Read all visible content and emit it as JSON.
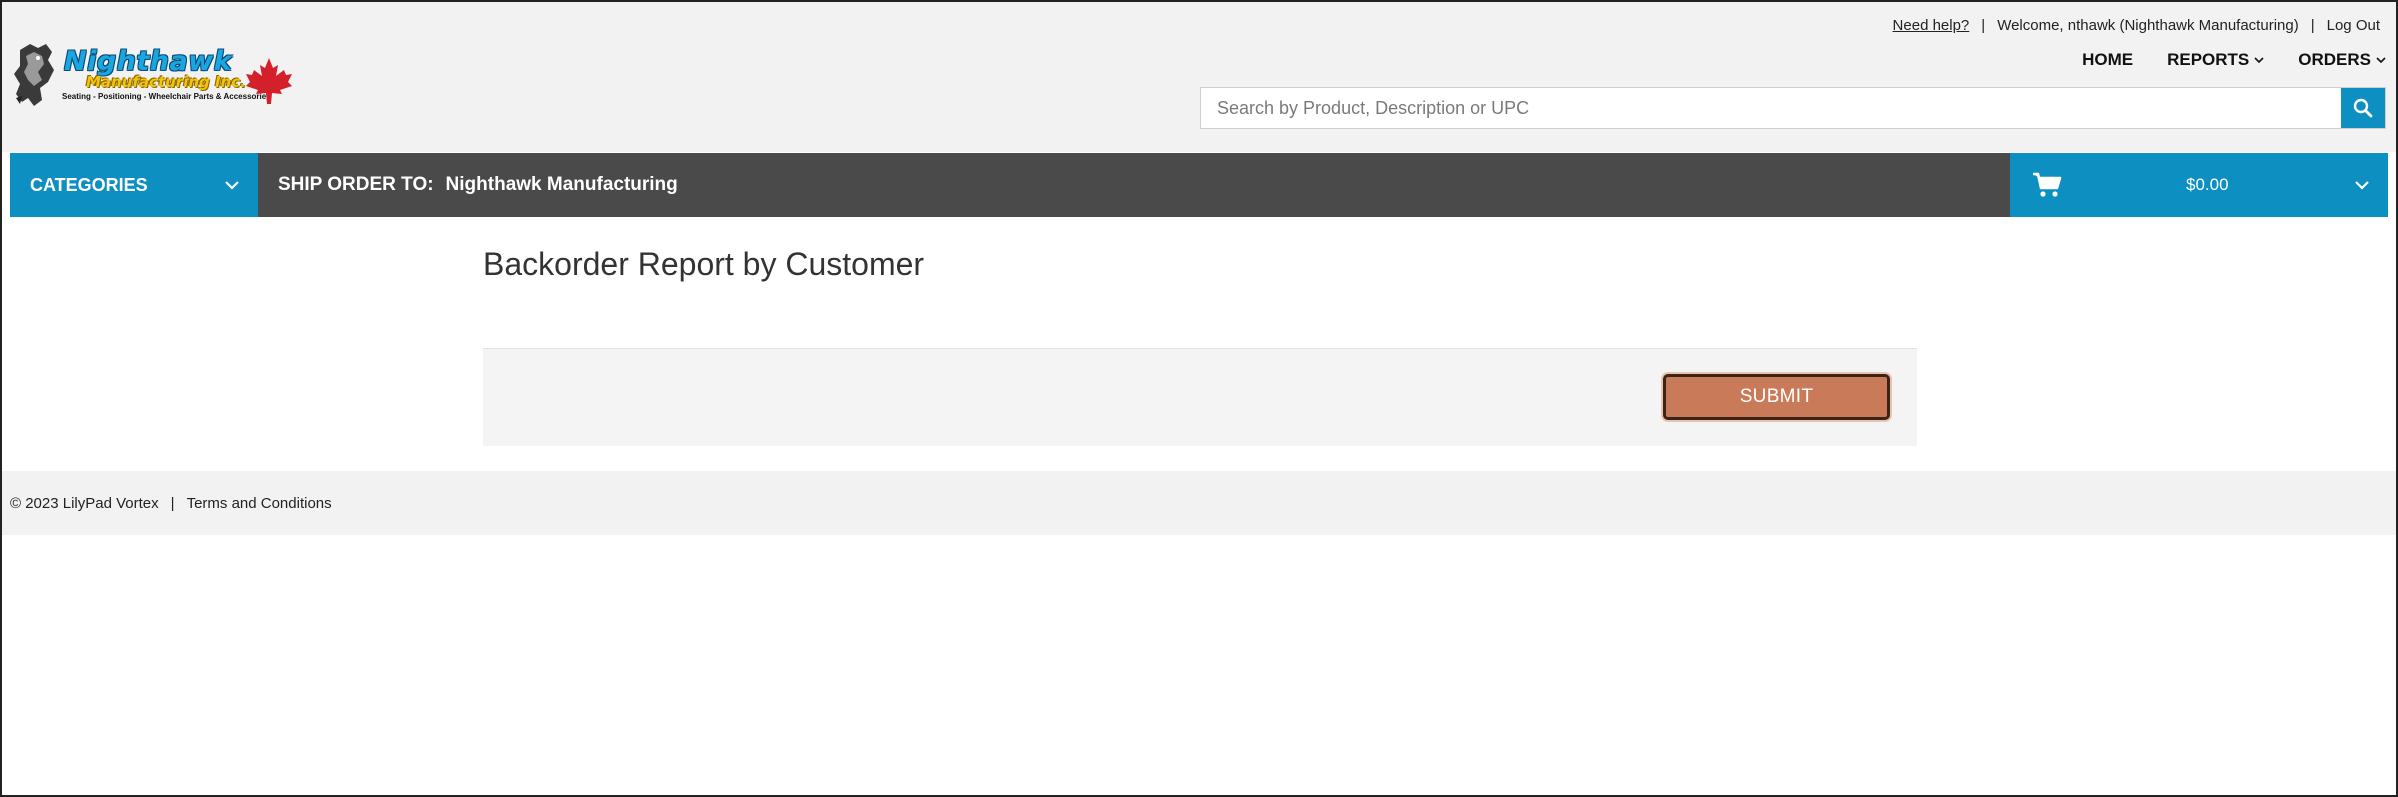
{
  "brand": {
    "name": "Nighthawk",
    "subname": "Manufacturing Inc.",
    "tagline": "Seating - Positioning - Wheelchair Parts & Accessories"
  },
  "top_links": {
    "help": "Need help?",
    "welcome": "Welcome, nthawk (Nighthawk Manufacturing)",
    "logout": "Log Out"
  },
  "nav": {
    "home": "HOME",
    "reports": "REPORTS",
    "orders": "ORDERS"
  },
  "search": {
    "placeholder": "Search by Product, Description or UPC"
  },
  "bar": {
    "categories": "CATEGORIES",
    "ship_label": "SHIP ORDER TO:",
    "ship_value": "Nighthawk Manufacturing",
    "cart_total": "$0.00"
  },
  "main": {
    "title": "Backorder Report by Customer",
    "submit_label": "SUBMIT"
  },
  "footer": {
    "copyright": "© 2023 LilyPad Vortex",
    "terms": "Terms and Conditions"
  },
  "colors": {
    "accent_blue": "#0e8fc2",
    "bar_dark": "#4a4a4a",
    "submit": "#c97b59",
    "maple_red": "#d3202b"
  },
  "icons": {
    "search": "search-icon",
    "cart": "cart-icon",
    "chevron": "chevron-down-icon",
    "logo_bird": "hawk-icon",
    "logo_leaf": "maple-leaf-icon"
  }
}
